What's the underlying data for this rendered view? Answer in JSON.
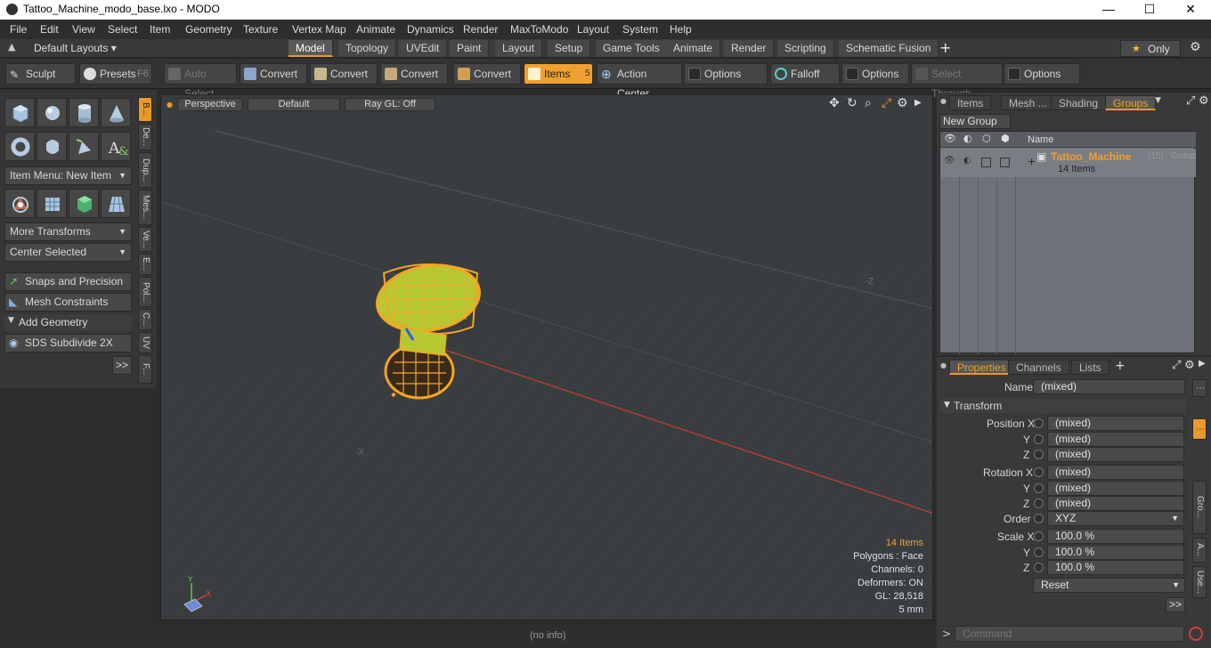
{
  "window": {
    "title": "Tattoo_Machine_modo_base.lxo - MODO",
    "minimize": "—",
    "maximize": "☐",
    "close": "✕"
  },
  "menu": [
    "File",
    "Edit",
    "View",
    "Select",
    "Item",
    "Geometry",
    "Texture",
    "Vertex Map",
    "Animate",
    "Dynamics",
    "Render",
    "MaxToModo",
    "Layout",
    "System",
    "Help"
  ],
  "layoutbar": {
    "preset": "Default Layouts ▾",
    "tabs": [
      "Model",
      "Topology",
      "UVEdit",
      "Paint",
      "Layout",
      "Setup",
      "Game Tools",
      "Animate",
      "Render",
      "Scripting",
      "Schematic Fusion"
    ],
    "active_tab": "Model",
    "add": "+",
    "only": "Only",
    "star": "★"
  },
  "toolbar": {
    "sculpt": "Sculpt",
    "presets": "Presets",
    "presets_key": "F6",
    "auto_select": "Auto Select",
    "convert1": "Convert",
    "convert2": "Convert",
    "convert3": "Convert",
    "convert4": "Convert",
    "items": "Items",
    "items_key": "5",
    "action_center": "Action Center",
    "options1": "Options",
    "falloff": "Falloff",
    "options2": "Options",
    "select_through": "Select Through",
    "options3": "Options"
  },
  "leftpanel": {
    "item_menu": "Item Menu: New Item",
    "more_transforms": "More Transforms",
    "center_selected": "Center Selected",
    "snaps": "Snaps and Precision",
    "mesh_constraints": "Mesh Constraints",
    "add_geometry": "Add Geometry",
    "sds": "SDS Subdivide 2X",
    "more": ">>",
    "vtabs": [
      "B...",
      "De...",
      "Dup...",
      "Mes...",
      "Ve...",
      "E...",
      "Pol...",
      "C...",
      "UV",
      "F..."
    ]
  },
  "viewport": {
    "view": "Perspective",
    "shading": "Default",
    "raygl": "Ray GL: Off",
    "axis_z_label": "Z",
    "axis_x_label": "X",
    "hud": {
      "items": "14 Items",
      "polygons": "Polygons : Face",
      "channels": "Channels: 0",
      "deformers": "Deformers: ON",
      "gl": "GL: 28,518",
      "unit": "5 mm"
    }
  },
  "statusbar": {
    "info": "(no info)"
  },
  "groups": {
    "tabs": [
      "Items",
      "Mesh ...",
      "Shading",
      "Groups"
    ],
    "active_tab": "Groups",
    "new_group": "New Group",
    "col_name": "Name",
    "group_name": "Tattoo_Machine",
    "group_suffix": "(15) : Group",
    "group_count": "14 Items"
  },
  "properties": {
    "tabs": [
      "Properties",
      "Channels",
      "Lists"
    ],
    "active_tab": "Properties",
    "add": "+",
    "name_label": "Name",
    "name_value": "(mixed)",
    "transform": "Transform",
    "position_x_label": "Position X",
    "y_label": "Y",
    "z_label": "Z",
    "rotation_x_label": "Rotation X",
    "order_label": "Order",
    "scale_x_label": "Scale X",
    "mixed": "(mixed)",
    "order_value": "XYZ",
    "scale_value": "100.0 %",
    "reset": "Reset",
    "more": ">>",
    "side_tabs": [
      "Gro...",
      "A...",
      "Use..."
    ]
  },
  "command": {
    "prompt": ">",
    "placeholder": "Command"
  },
  "colors": {
    "accent": "#e99a2a",
    "mesh": "#f5a623",
    "mesh_inner": "#b6c832"
  }
}
